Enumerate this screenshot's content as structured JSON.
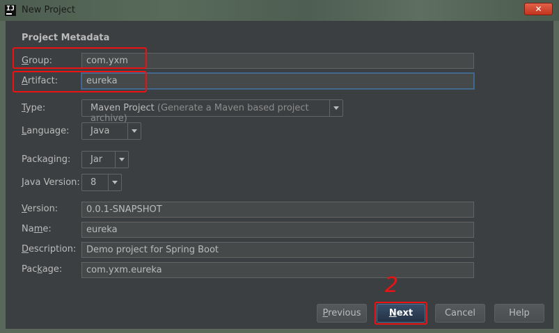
{
  "window": {
    "title": "New Project",
    "close_glyph": "✕",
    "icon": "intellij-icon"
  },
  "section_title": "Project Metadata",
  "fields": {
    "group": {
      "label_prefix": "G",
      "label_rest": "roup:",
      "value": "com.yxm"
    },
    "artifact": {
      "label_prefix": "A",
      "label_rest": "rtifact:",
      "value": "eureka"
    },
    "type": {
      "label_prefix": "T",
      "label_rest": "ype:",
      "value": "Maven Project",
      "hint": "(Generate a Maven based project archive)"
    },
    "language": {
      "label_prefix": "L",
      "label_rest": "anguage:",
      "value": "Java"
    },
    "packaging": {
      "label_pre": "Packa",
      "label_prefix": "g",
      "label_rest": "ing:",
      "value": "Jar"
    },
    "java_version": {
      "label_prefix": "J",
      "label_rest": "ava Version:",
      "value": "8"
    },
    "version": {
      "label_prefix": "V",
      "label_rest": "ersion:",
      "value": "0.0.1-SNAPSHOT"
    },
    "name": {
      "label_pre": "Na",
      "label_prefix": "m",
      "label_rest": "e:",
      "value": "eureka"
    },
    "description": {
      "label_prefix": "D",
      "label_rest": "escription:",
      "value": "Demo project for Spring Boot"
    },
    "package": {
      "label_pre": "Pac",
      "label_prefix": "k",
      "label_rest": "age:",
      "value": "com.yxm.eureka"
    }
  },
  "buttons": {
    "previous": {
      "label_prefix": "P",
      "label_rest": "revious"
    },
    "next": {
      "label_prefix": "N",
      "label_rest": "ext"
    },
    "cancel": "Cancel",
    "help": "Help"
  },
  "annotation": {
    "number": "2",
    "color": "#ee1111"
  },
  "colors": {
    "background": "#3c3f41",
    "field_bg": "#45494a",
    "focus": "#466d94",
    "highlight_red": "#ee1111"
  }
}
